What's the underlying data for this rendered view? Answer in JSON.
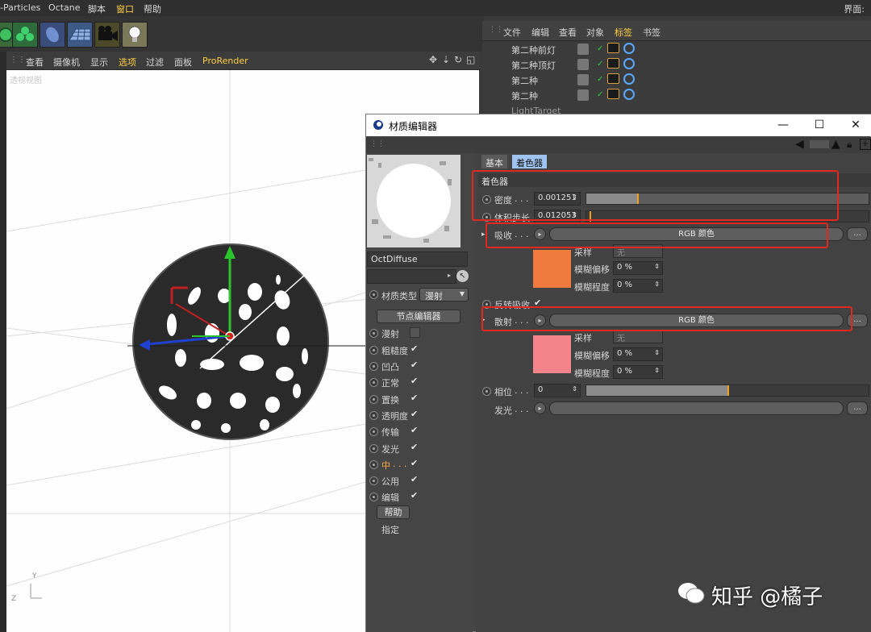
{
  "menubar": {
    "items": [
      "-Particles",
      "Octane",
      "脚本",
      "窗口",
      "帮助"
    ],
    "active_index": 3,
    "right_label": "界面:"
  },
  "toolbar": {
    "buttons": [
      "tool-1-icon",
      "cloner-icon",
      "deformer-icon",
      "floor-icon",
      "camera-icon",
      "light-icon"
    ]
  },
  "viewport": {
    "menu": [
      "查看",
      "摄像机",
      "显示",
      "选项",
      "过滤",
      "面板",
      "ProRender"
    ],
    "active_index": 3,
    "view_label": "透视视图",
    "axis_y": "Y",
    "axis_z": "Z"
  },
  "object_manager": {
    "menu": [
      "文件",
      "编辑",
      "查看",
      "对象",
      "标签",
      "书签"
    ],
    "active_index": 4,
    "objects": [
      {
        "name": "第二种前灯"
      },
      {
        "name": "第二种顶灯"
      },
      {
        "name": "第二种"
      },
      {
        "name": "第二种"
      },
      {
        "name": "LightTarget"
      }
    ]
  },
  "material_editor": {
    "title": "材质编辑器",
    "window_controls": {
      "minimize": "—",
      "maximize": "☐",
      "close": "✕"
    },
    "material_name": "OctDiffuse",
    "material_type_label": "材质类型",
    "material_type_value": "漫射",
    "node_editor_button": "节点编辑器",
    "channels": [
      {
        "label": "漫射",
        "checked": false
      },
      {
        "label": "粗糙度",
        "checked": true
      },
      {
        "label": "凹凸",
        "checked": true
      },
      {
        "label": "正常",
        "checked": true
      },
      {
        "label": "置换",
        "checked": true
      },
      {
        "label": "透明度",
        "checked": true
      },
      {
        "label": "传输",
        "checked": true
      },
      {
        "label": "发光",
        "checked": true
      },
      {
        "label": "中",
        "checked": true,
        "highlight": true
      },
      {
        "label": "公用",
        "checked": true
      },
      {
        "label": "编辑",
        "checked": true
      }
    ],
    "help_button": "帮助",
    "assign_label": "指定",
    "tabs": [
      "基本",
      "着色器"
    ],
    "active_tab": 1,
    "section_title": "着色器",
    "density": {
      "label": "密度",
      "value": "0.001251",
      "fraction": 0.18
    },
    "step_length": {
      "label": "体积步长",
      "value": "0.012053",
      "fraction": 0.01
    },
    "absorption": {
      "label": "吸收",
      "shader": "RGB 颜色",
      "sampling_label": "采样",
      "sampling_value": "无",
      "blur_offset_label": "模糊偏移",
      "blur_offset_value": "0 %",
      "blur_scale_label": "模糊程度",
      "blur_scale_value": "0 %",
      "color": "#f07a3e"
    },
    "invert_absorption": {
      "label": "反转吸收",
      "checked": true
    },
    "scattering": {
      "label": "散射",
      "shader": "RGB 颜色",
      "sampling_label": "采样",
      "sampling_value": "无",
      "blur_offset_label": "模糊偏移",
      "blur_offset_value": "0 %",
      "blur_scale_label": "模糊程度",
      "blur_scale_value": "0 %",
      "color": "#f5848a"
    },
    "phase": {
      "label": "相位",
      "value": "0",
      "fraction": 0.5
    },
    "emission": {
      "label": "发光"
    },
    "more_button": "..."
  },
  "watermark": "知乎 @橘子",
  "colors": {
    "highlight_box": "#e0281e",
    "slider_marker": "#f0a020",
    "accent_blue": "#5aa8ff"
  }
}
